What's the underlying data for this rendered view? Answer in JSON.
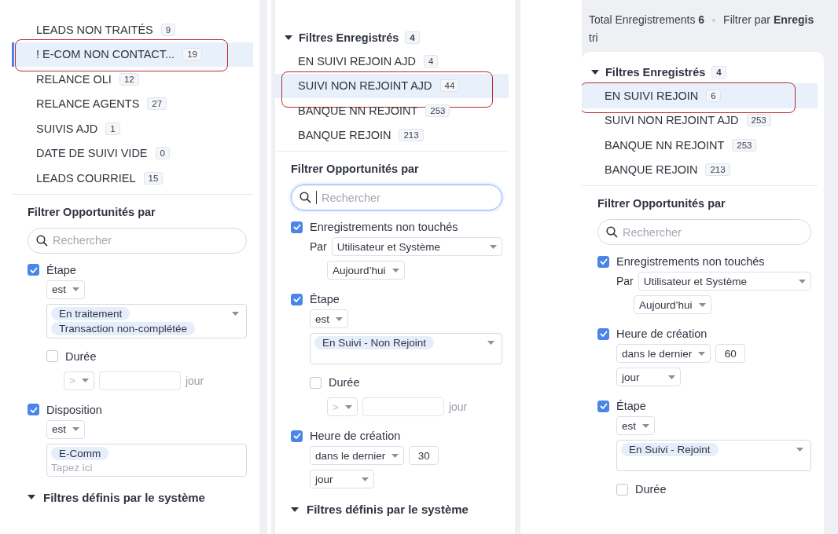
{
  "panels": [
    {
      "selection_bar": true,
      "saved_filters": {
        "items": [
          {
            "label": "LEADS NON TRAITÉS",
            "count": "9",
            "selected": false,
            "circled": false
          },
          {
            "label": "! E-COM NON CONTACT...",
            "count": "19",
            "selected": true,
            "circled": true
          },
          {
            "label": "RELANCE OLI",
            "count": "12",
            "selected": false,
            "circled": false
          },
          {
            "label": "RELANCE AGENTS",
            "count": "27",
            "selected": false,
            "circled": false
          },
          {
            "label": "SUIVIS AJD",
            "count": "1",
            "selected": false,
            "circled": false
          },
          {
            "label": "DATE DE SUIVI VIDE",
            "count": "0",
            "selected": false,
            "circled": false
          },
          {
            "label": "LEADS COURRIEL",
            "count": "15",
            "selected": false,
            "circled": false
          }
        ]
      },
      "filter_section": {
        "title": "Filtrer Opportunités par",
        "search": {
          "placeholder": "Rechercher",
          "focused": false
        },
        "filters": [
          {
            "kind": "picklist",
            "label": "Étape",
            "checked": true,
            "operator": "est",
            "tags": [
              "En traitement",
              "Transaction non-complétée"
            ],
            "dropdown": true,
            "duration": {
              "label": "Durée",
              "checked": false,
              "operator": ">",
              "unit": "jour"
            }
          },
          {
            "kind": "picklist",
            "label": "Disposition",
            "checked": true,
            "operator": "est",
            "tags": [
              "E-Comm"
            ],
            "dropdown": false,
            "placeholder": "Tapez ici"
          }
        ]
      },
      "system_filters": {
        "title": "Filtres définis par le système",
        "expanded": true
      }
    },
    {
      "selection_bar": false,
      "saved_filters": {
        "title": "Filtres Enregistrés",
        "count": "4",
        "expanded": true,
        "items": [
          {
            "label": "EN SUIVI REJOIN AJD",
            "count": "4",
            "selected": false,
            "circled": false
          },
          {
            "label": "SUIVI NON REJOINT AJD",
            "count": "44",
            "selected": true,
            "circled": true
          },
          {
            "label": "BANQUE NN REJOINT",
            "count": "253",
            "selected": false,
            "circled": false
          },
          {
            "label": "BANQUE REJOIN",
            "count": "213",
            "selected": false,
            "circled": false
          }
        ]
      },
      "filter_section": {
        "title": "Filtrer Opportunités par",
        "search": {
          "placeholder": "Rechercher",
          "focused": true
        },
        "filters": [
          {
            "kind": "untouched",
            "label": "Enregistrements non touchés",
            "checked": true,
            "by_label": "Par",
            "by_value": "Utilisateur et Système",
            "period": "Aujourd’hui"
          },
          {
            "kind": "picklist",
            "label": "Étape",
            "checked": true,
            "operator": "est",
            "tags": [
              "En Suivi - Non Rejoint"
            ],
            "dropdown": true,
            "duration": {
              "label": "Durée",
              "checked": false,
              "operator": ">",
              "unit": "jour"
            }
          },
          {
            "kind": "created",
            "label": "Heure de création",
            "checked": true,
            "operator": "dans le dernier",
            "value": "30",
            "unit": "jour"
          }
        ]
      },
      "system_filters": {
        "title": "Filtres définis par le système",
        "expanded": true
      }
    },
    {
      "selection_bar": false,
      "header": {
        "total": "Total Enregistrements **6**",
        "filter": "Filtrer par **Enregis**",
        "continuation": "tri"
      },
      "saved_filters": {
        "title": "Filtres Enregistrés",
        "count": "4",
        "expanded": true,
        "items": [
          {
            "label": "EN SUIVI REJOIN",
            "count": "6",
            "selected": true,
            "circled": true
          },
          {
            "label": "SUIVI NON REJOINT AJD",
            "count": "253",
            "selected": false,
            "circled": false
          },
          {
            "label": "BANQUE NN REJOINT",
            "count": "253",
            "selected": false,
            "circled": false
          },
          {
            "label": "BANQUE REJOIN",
            "count": "213",
            "selected": false,
            "circled": false
          }
        ]
      },
      "filter_section": {
        "title": "Filtrer Opportunités par",
        "search": {
          "placeholder": "Rechercher",
          "focused": false
        },
        "filters": [
          {
            "kind": "untouched",
            "label": "Enregistrements non touchés",
            "checked": true,
            "by_label": "Par",
            "by_value": "Utilisateur et Système",
            "period": "Aujourd’hui"
          },
          {
            "kind": "created",
            "label": "Heure de création",
            "checked": true,
            "operator": "dans le dernier",
            "value": "60",
            "unit": "jour"
          },
          {
            "kind": "picklist",
            "label": "Étape",
            "checked": true,
            "operator": "est",
            "tags": [
              "En Suivi - Rejoint"
            ],
            "dropdown": true,
            "duration": {
              "label": "Durée",
              "checked": false
            }
          }
        ]
      }
    }
  ]
}
